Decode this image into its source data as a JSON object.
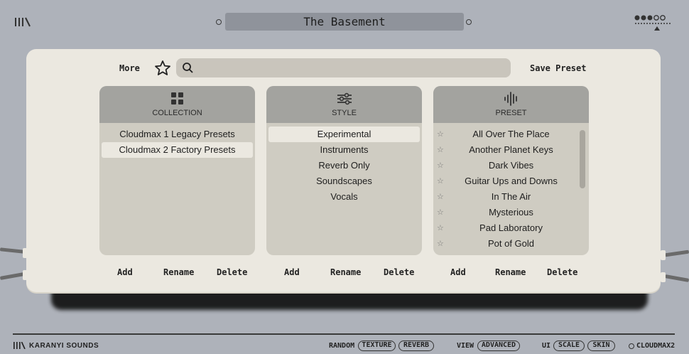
{
  "header": {
    "title": "The Basement"
  },
  "toolbar": {
    "more_label": "More",
    "search_placeholder": "",
    "save_label": "Save Preset"
  },
  "columns": {
    "collection": {
      "label": "COLLECTION",
      "items": [
        "Cloudmax 1 Legacy Presets",
        "Cloudmax 2 Factory Presets"
      ],
      "selected": 1
    },
    "style": {
      "label": "STYLE",
      "items": [
        "Experimental",
        "Instruments",
        "Reverb Only",
        "Soundscapes",
        "Vocals"
      ],
      "selected": 0
    },
    "preset": {
      "label": "PRESET",
      "items": [
        "All Over The Place",
        "Another Planet Keys",
        "Dark Vibes",
        "Guitar Ups and Downs",
        "In The Air",
        "Mysterious",
        "Pad Laboratory",
        "Pot of Gold"
      ]
    }
  },
  "actions": {
    "add": "Add",
    "rename": "Rename",
    "delete": "Delete"
  },
  "footer": {
    "brand": "KARANYI SOUNDS",
    "random_label": "RANDOM",
    "texture": "TEXTURE",
    "reverb": "REVERB",
    "view_label": "VIEW",
    "advanced": "ADVANCED",
    "ui_label": "UI",
    "scale": "SCALE",
    "skin": "SKIN",
    "product": "CLOUDMAX2"
  },
  "icons": {
    "logo": "bars-logo-icon",
    "dots": "preset-dots-icon",
    "collection": "grid-icon",
    "style": "sliders-icon",
    "preset": "waveform-icon",
    "star": "star-icon",
    "search": "search-icon"
  },
  "colors": {
    "background": "#aeb2ba",
    "panel": "#ebe8e0",
    "column": "#cfccc2",
    "column_header": "#a3a39f",
    "title_bar": "#8f939b"
  }
}
